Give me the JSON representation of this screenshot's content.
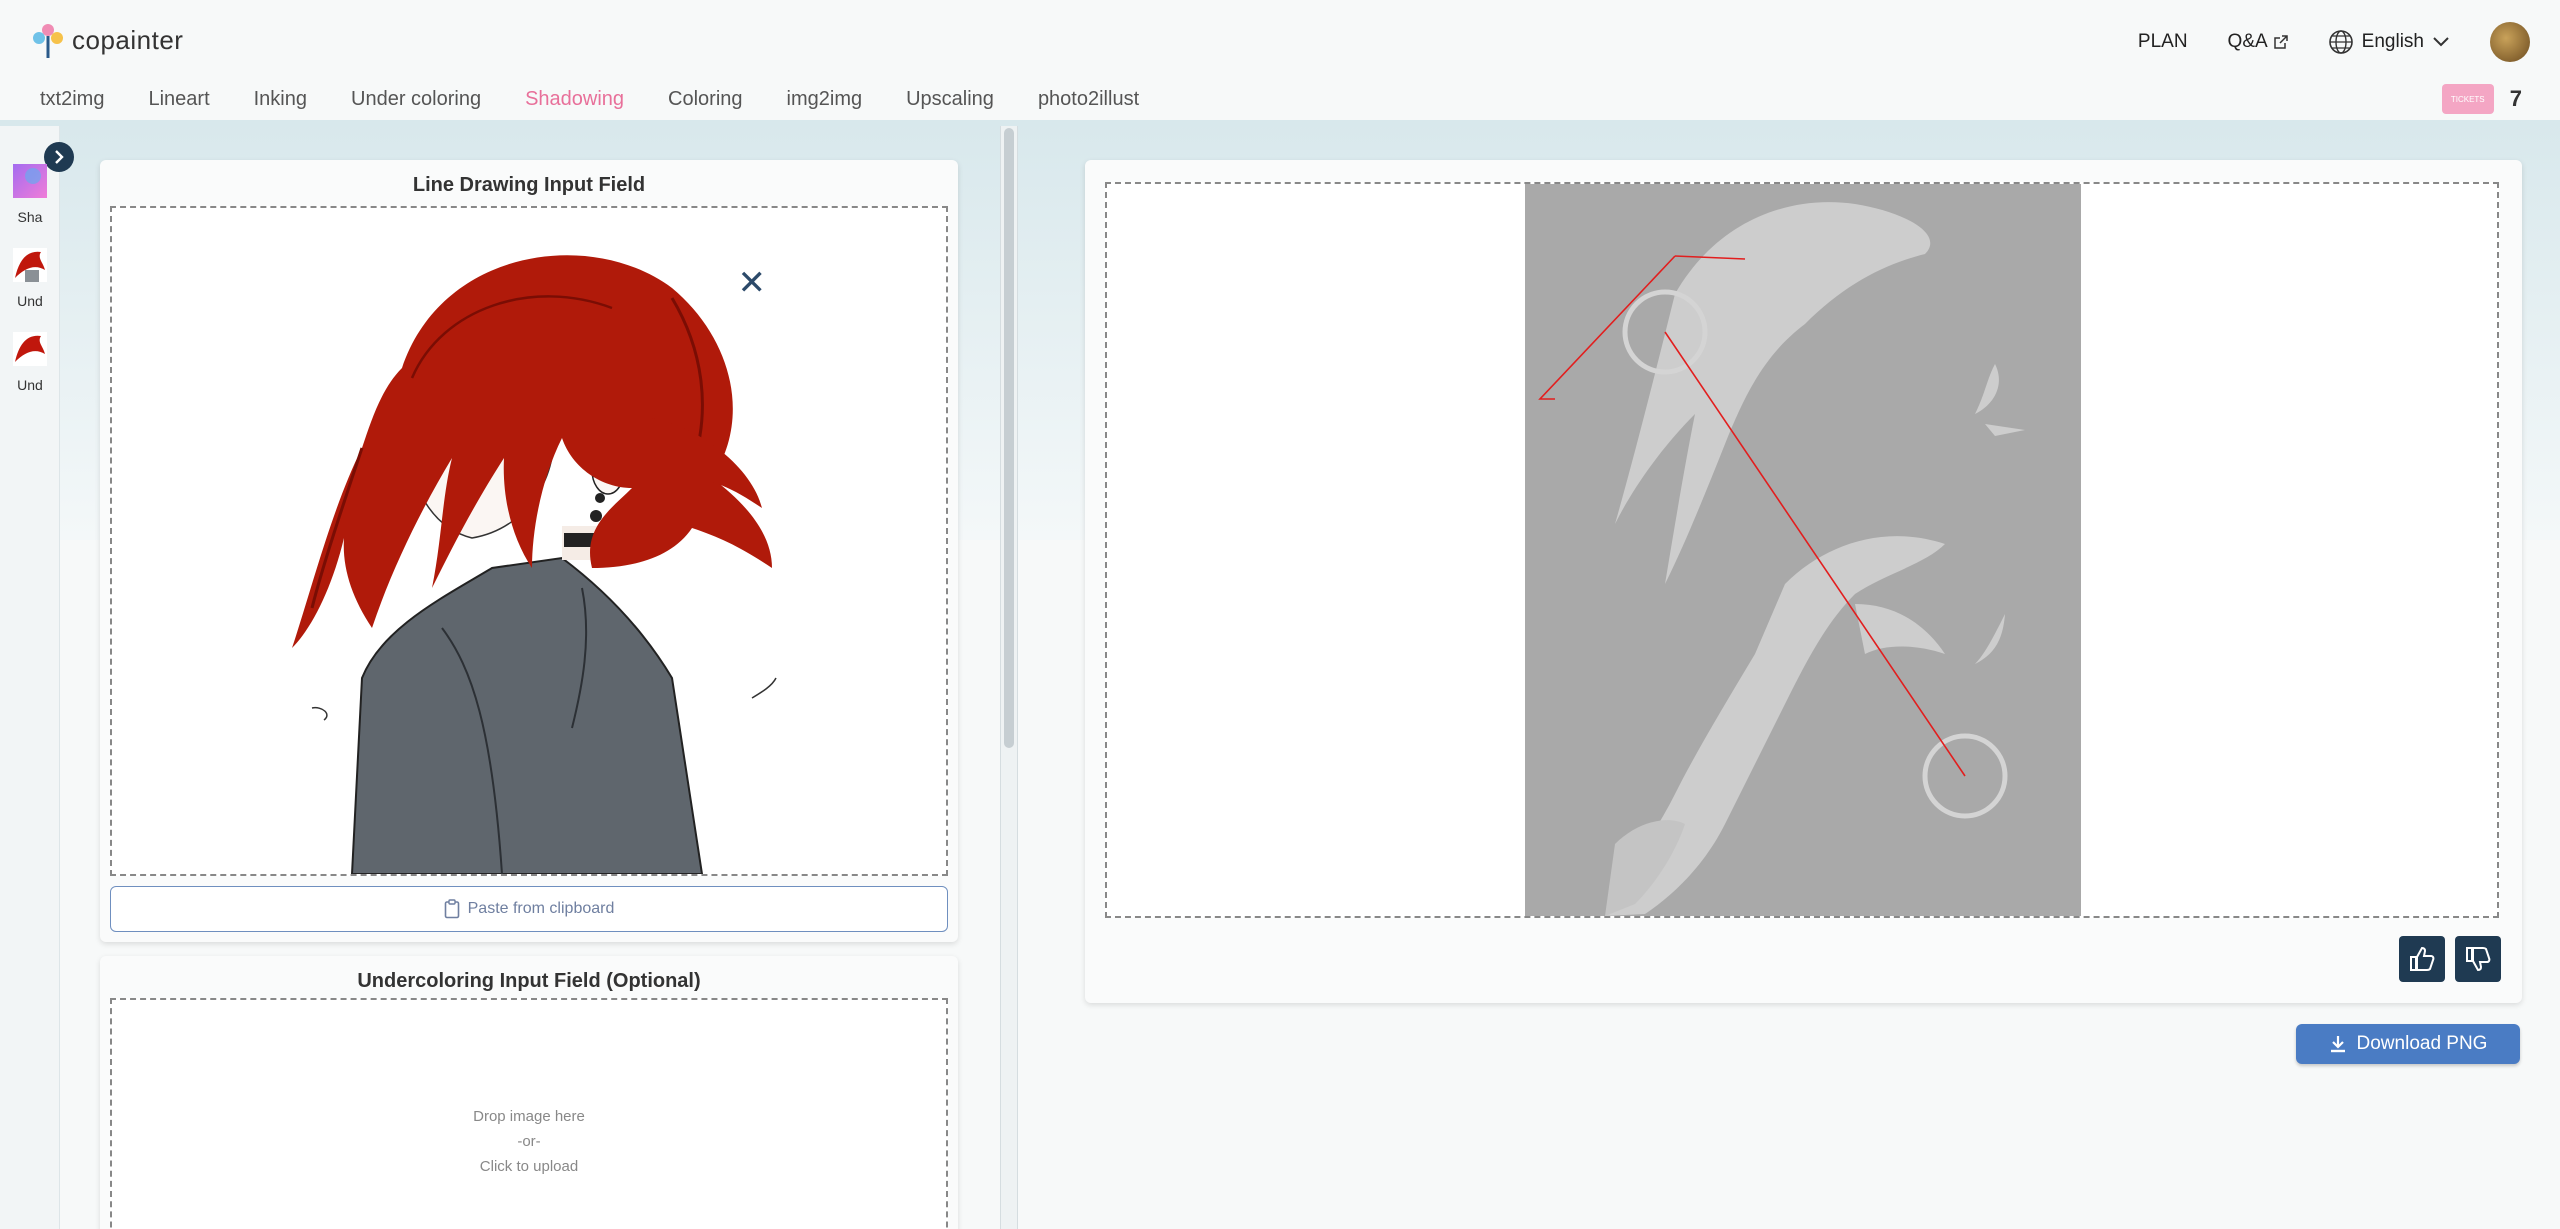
{
  "app": {
    "name": "copainter"
  },
  "header": {
    "plan_label": "PLAN",
    "qa_label": "Q&A",
    "language_label": "English"
  },
  "tabs": [
    {
      "label": "txt2img"
    },
    {
      "label": "Lineart"
    },
    {
      "label": "Inking"
    },
    {
      "label": "Under coloring"
    },
    {
      "label": "Shadowing",
      "active": true
    },
    {
      "label": "Coloring"
    },
    {
      "label": "img2img"
    },
    {
      "label": "Upscaling"
    },
    {
      "label": "photo2illust"
    }
  ],
  "tickets": {
    "badge_label": "TICKETS",
    "count": "7"
  },
  "history": [
    {
      "label": "Sha"
    },
    {
      "label": "Und"
    },
    {
      "label": "Und"
    }
  ],
  "line_drawing": {
    "title": "Line Drawing Input Field",
    "paste_label": "Paste from clipboard"
  },
  "undercoloring": {
    "title": "Undercoloring Input Field (Optional)",
    "drop_text": "Drop image here",
    "or_text": "-or-",
    "click_text": "Click to upload"
  },
  "result": {
    "download_label": "Download PNG"
  },
  "colors": {
    "accent_tab": "#e8709a",
    "primary_button": "#4a7cc4",
    "dark_button": "#1f3a52",
    "hair_red": "#b01a0a",
    "shadow_gray": "#a9a9a9"
  }
}
